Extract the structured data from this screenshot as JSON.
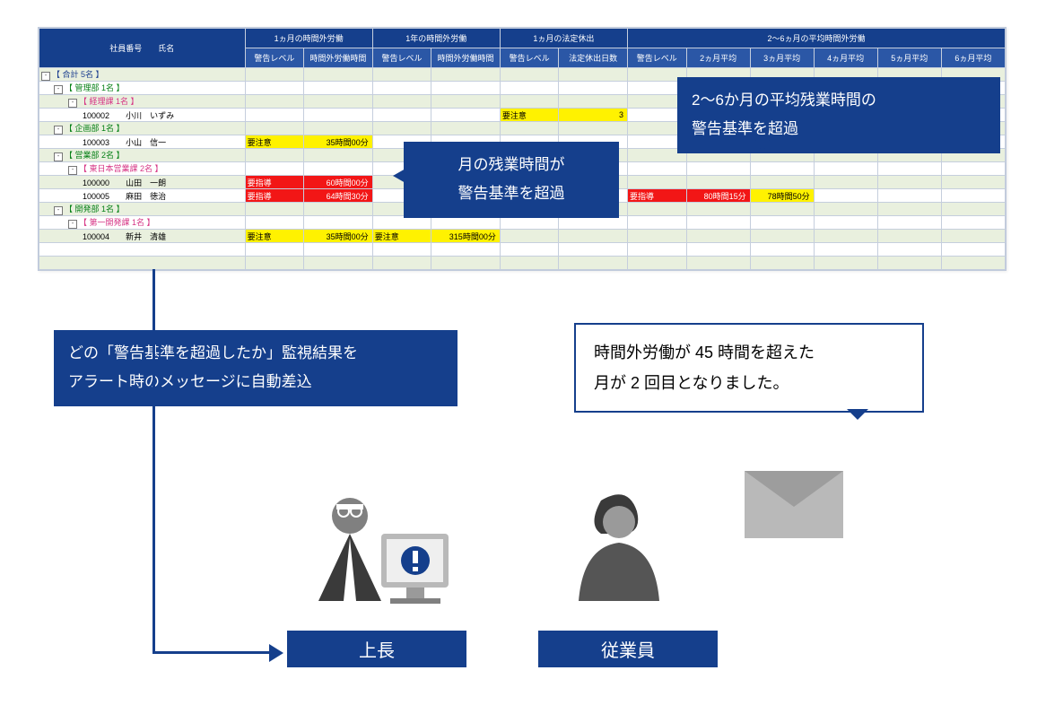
{
  "headers": {
    "col0": "社員番号　　氏名",
    "g1": "1ヵ月の時間外労働",
    "g2": "1年の時間外労働",
    "g3": "1ヵ月の法定休出",
    "g4": "2～6ヵ月の平均時間外労働",
    "c1": "警告レベル",
    "c2": "時間外労働時間",
    "c3": "警告レベル",
    "c4": "時間外労働時間",
    "c5": "警告レベル",
    "c6": "法定休出日数",
    "c7": "警告レベル",
    "c8": "2ヵ月平均",
    "c9": "3ヵ月平均",
    "c10": "4ヵ月平均",
    "c11": "5ヵ月平均",
    "c12": "6ヵ月平均"
  },
  "rows": {
    "total": "【 合計                       5名 】",
    "kanri": "【 管理部                 1名 】",
    "keiri": "【 経理課                 1名 】",
    "emp1_id": "100002",
    "emp1_name": "小川　いずみ",
    "kikaku": "【 企画部                 1名 】",
    "emp2_id": "100003",
    "emp2_name": "小山　信一",
    "eigyo": "【 営業部                 2名 】",
    "higashi": "【 東日本営業課         2名 】",
    "emp3_id": "100000",
    "emp3_name": "山田　一朗",
    "emp4_id": "100005",
    "emp4_name": "麻田　徳治",
    "kaihatsu": "【 開発部                 1名 】",
    "dai1": "【 第一開発課            1名 】",
    "emp5_id": "100004",
    "emp5_name": "新井　清雄"
  },
  "cells": {
    "emp1_lv3": "要注意",
    "emp1_days": "3",
    "emp2_lv1": "要注意",
    "emp2_h1": "35時間00分",
    "emp3_lv1": "要指導",
    "emp3_h1": "60時間00分",
    "emp4_lv1": "要指導",
    "emp4_h1": "64時間30分",
    "emp4_lv4": "要指導",
    "emp4_m2": "80時間15分",
    "emp4_m3": "78時間50分",
    "emp5_lv1": "要注意",
    "emp5_h1": "35時間00分",
    "emp5_lv2": "要注意",
    "emp5_h2": "315時間00分"
  },
  "callouts": {
    "avg": "2〜6か月の平均残業時間の\n警告基準を超過",
    "month": "月の残業時間が\n警告基準を超過",
    "insert": "どの「警告基準を超過したか」監視結果を\nアラート時のメッセージに自動差込",
    "speech": "時間外労働が 45 時間を超えた\n月が 2 回目となりました。"
  },
  "labels": {
    "boss": "上長",
    "emp": "従業員"
  }
}
